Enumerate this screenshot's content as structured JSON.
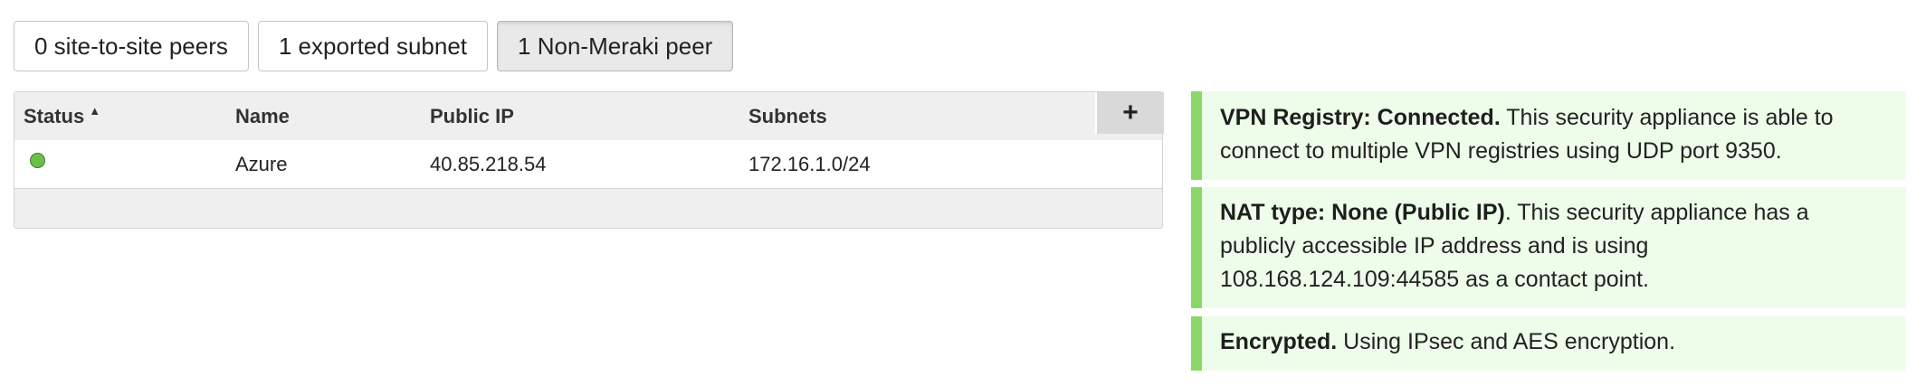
{
  "tabs": [
    {
      "label": "0 site-to-site peers",
      "active": false
    },
    {
      "label": "1 exported subnet",
      "active": false
    },
    {
      "label": "1 Non-Meraki peer",
      "active": true
    }
  ],
  "table": {
    "headers": {
      "status": "Status",
      "sort_indicator": "▲",
      "name": "Name",
      "public_ip": "Public IP",
      "subnets": "Subnets"
    },
    "add_label": "+",
    "rows": [
      {
        "status": "online",
        "name": "Azure",
        "public_ip": "40.85.218.54",
        "subnets": "172.16.1.0/24"
      }
    ]
  },
  "status_panels": {
    "registry": {
      "title": "VPN Registry: Connected.",
      "text": " This security appliance is able to connect to multiple VPN registries using UDP port 9350."
    },
    "nat": {
      "title": "NAT type: None (Public IP)",
      "text": ". This security appliance has a publicly accessible IP address and is using 108.168.124.109:44585 as a contact point."
    },
    "encryption": {
      "title": "Encrypted.",
      "text": " Using IPsec and AES encryption."
    }
  },
  "colors": {
    "status_online": "#6cc04a",
    "panel_accent": "#8bd86a",
    "panel_background": "#edfdea"
  }
}
